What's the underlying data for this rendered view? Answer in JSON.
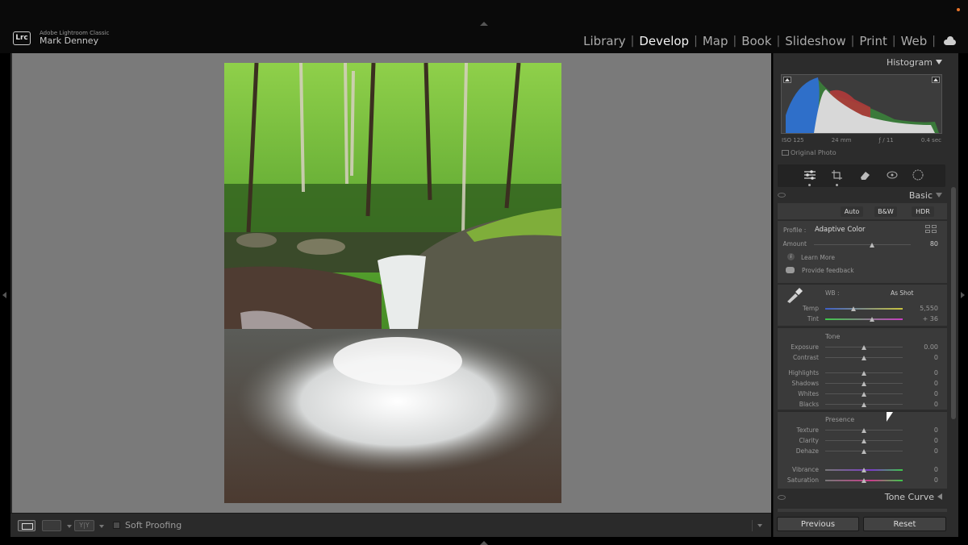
{
  "app": {
    "badge": "Lrc",
    "name": "Adobe Lightroom Classic",
    "user": "Mark Denney"
  },
  "modules": [
    {
      "label": "Library",
      "active": false
    },
    {
      "label": "Develop",
      "active": true
    },
    {
      "label": "Map",
      "active": false
    },
    {
      "label": "Book",
      "active": false
    },
    {
      "label": "Slideshow",
      "active": false
    },
    {
      "label": "Print",
      "active": false
    },
    {
      "label": "Web",
      "active": false
    }
  ],
  "toolbar": {
    "yy_label": "Y|Y",
    "soft_proofing": "Soft Proofing"
  },
  "histogram": {
    "title": "Histogram",
    "iso": "ISO 125",
    "focal": "24 mm",
    "aperture": "ƒ / 11",
    "shutter": "0.4 sec",
    "original_photo": "Original Photo"
  },
  "basic": {
    "title": "Basic",
    "buttons": {
      "auto": "Auto",
      "bw": "B&W",
      "hdr": "HDR"
    },
    "profile_label": "Profile :",
    "profile_value": "Adaptive Color",
    "amount_label": "Amount",
    "amount_value": "80",
    "amount_level": 0.6,
    "learn_more": "Learn More",
    "provide_feedback": "Provide feedback",
    "wb_label": "WB :",
    "wb_value": "As Shot",
    "temp": {
      "label": "Temp",
      "value": "5,550",
      "level": 0.36
    },
    "tint": {
      "label": "Tint",
      "value": "+ 36",
      "level": 0.6
    },
    "tone_title": "Tone",
    "tone": [
      {
        "label": "Exposure",
        "value": "0.00"
      },
      {
        "label": "Contrast",
        "value": "0"
      },
      {
        "label": "Highlights",
        "value": "0"
      },
      {
        "label": "Shadows",
        "value": "0"
      },
      {
        "label": "Whites",
        "value": "0"
      },
      {
        "label": "Blacks",
        "value": "0"
      }
    ],
    "presence_title": "Presence",
    "presence": [
      {
        "label": "Texture",
        "value": "0"
      },
      {
        "label": "Clarity",
        "value": "0"
      },
      {
        "label": "Dehaze",
        "value": "0"
      },
      {
        "label": "Vibrance",
        "value": "0"
      },
      {
        "label": "Saturation",
        "value": "0"
      }
    ]
  },
  "tone_curve": {
    "title": "Tone Curve"
  },
  "footer": {
    "previous": "Previous",
    "reset": "Reset"
  },
  "colors": {
    "accent_orange": "#e8742a",
    "panel": "#2c2c2c",
    "view_bg": "#7a7a7a"
  }
}
